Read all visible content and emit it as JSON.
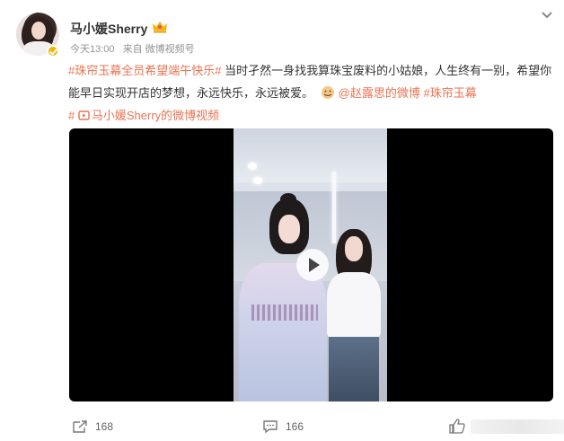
{
  "post": {
    "author": "马小媛Sherry",
    "time": "今天13:00",
    "source": "来自 微博视频号",
    "hashtag_start": "#珠帘玉幕全员希望端午快乐#",
    "body_text_1": " 当时孑然一身找我算珠宝废料的小姑娘，人生终有一别，希望你能早日实现开店的梦想，永远快乐，永远被爱。",
    "mention": "@赵露思的微博",
    "hashtag_end_a": "#珠帘玉幕",
    "hashtag_end_b": "#",
    "video_link": "马小媛Sherry的微博视频"
  },
  "actions": {
    "repost_count": "168",
    "comment_count": "166"
  },
  "colors": {
    "link": "#eb7350",
    "badge": "#f5b400"
  },
  "icons": {
    "verified": "verified-badge-icon",
    "crown": "crown-icon",
    "chevron": "chevron-down-icon",
    "emoji": "hug-emoji-icon",
    "video_link": "video-link-icon",
    "repost": "repost-icon",
    "comment": "comment-icon",
    "like": "like-icon"
  }
}
